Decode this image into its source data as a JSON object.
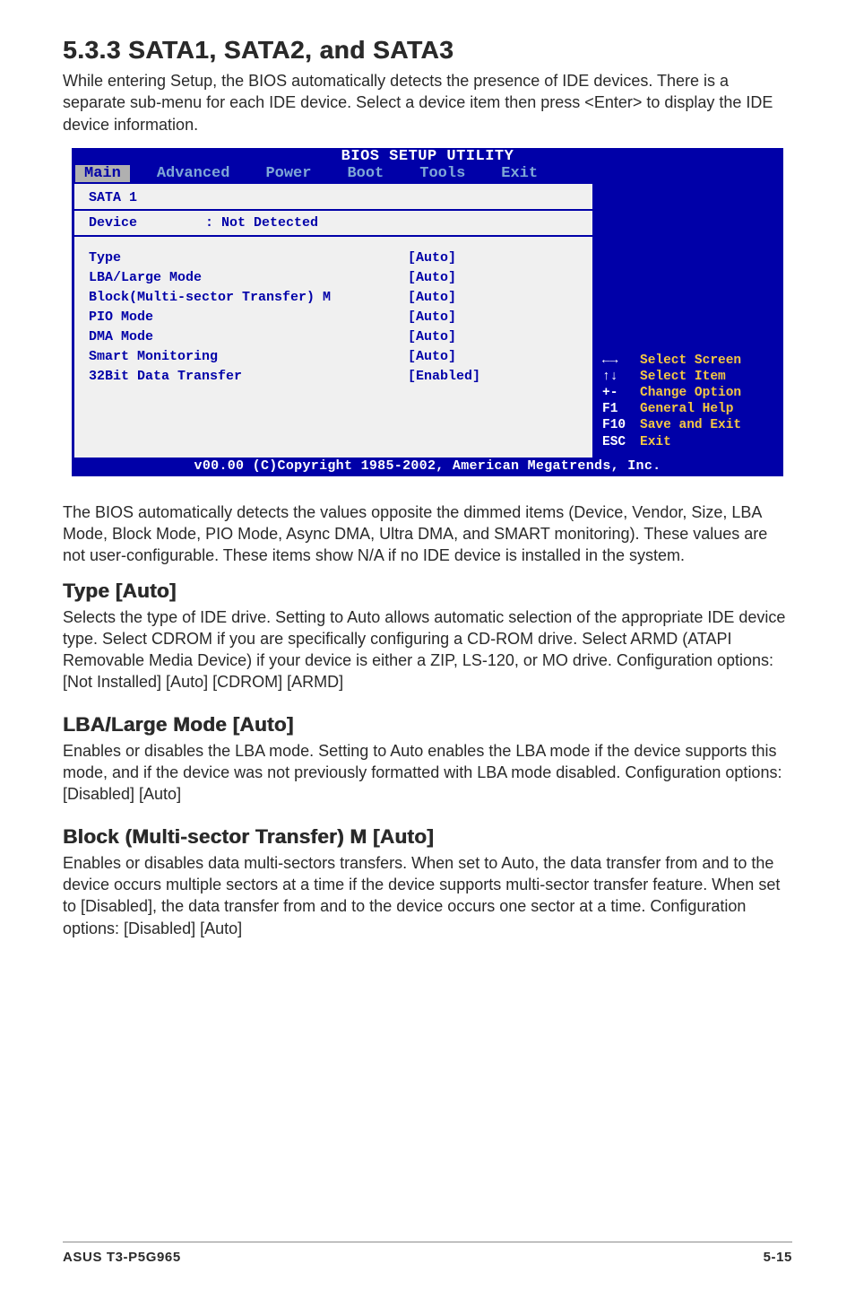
{
  "h2": "5.3.3   SATA1, SATA2, and SATA3",
  "intro": "While entering Setup, the BIOS automatically detects the presence of IDE devices. There is a separate sub-menu for each IDE device. Select a device item then press <Enter> to display the IDE device information.",
  "bios": {
    "title": "BIOS SETUP UTILITY",
    "tabs": [
      "Main",
      "Advanced",
      "Power",
      "Boot",
      "Tools",
      "Exit"
    ],
    "active_tab": "Main",
    "section_title": "SATA 1",
    "device_label": "Device",
    "device_value": ": Not Detected",
    "rows": [
      {
        "label": "Type",
        "val": "[Auto]"
      },
      {
        "label": "LBA/Large Mode",
        "val": "[Auto]"
      },
      {
        "label": "Block(Multi-sector Transfer) M",
        "val": "[Auto]"
      },
      {
        "label": "PIO Mode",
        "val": "[Auto]"
      },
      {
        "label": "DMA Mode",
        "val": "[Auto]"
      },
      {
        "label": "Smart Monitoring",
        "val": "[Auto]"
      },
      {
        "label": "32Bit Data Transfer",
        "val": "[Enabled]"
      }
    ],
    "help": [
      {
        "key": "←→",
        "lbl": "Select Screen"
      },
      {
        "key": "↑↓",
        "lbl": "Select Item"
      },
      {
        "key": "+-",
        "lbl": "Change Option"
      },
      {
        "key": "F1",
        "lbl": "General Help"
      },
      {
        "key": "F10",
        "lbl": "Save and Exit"
      },
      {
        "key": "ESC",
        "lbl": "Exit"
      }
    ],
    "footer": "v00.00 (C)Copyright 1985-2002, American Megatrends, Inc."
  },
  "after_bios": "The BIOS automatically detects the values opposite the dimmed items (Device, Vendor, Size, LBA Mode, Block Mode, PIO Mode, Async DMA, Ultra DMA, and SMART monitoring). These values are not user-configurable. These items show N/A if no IDE device is installed in the system.",
  "type": {
    "h": "Type [Auto]",
    "p": "Selects the type of IDE drive. Setting to Auto allows automatic selection of the appropriate IDE device type. Select CDROM if you are specifically configuring a CD-ROM drive. Select ARMD (ATAPI Removable Media Device) if your device is either a ZIP, LS-120, or MO drive. Configuration options: [Not Installed] [Auto] [CDROM] [ARMD]"
  },
  "lba": {
    "h": "LBA/Large Mode [Auto]",
    "p": "Enables or disables the LBA mode. Setting to Auto enables the LBA mode if the device supports this mode, and if the device was not previously formatted with LBA mode disabled. Configuration options: [Disabled] [Auto]"
  },
  "block": {
    "h": "Block (Multi-sector Transfer) M [Auto]",
    "p": "Enables or disables data multi-sectors transfers. When set to Auto, the data transfer from and to the device occurs multiple sectors at a time if the device supports multi-sector transfer feature. When set to [Disabled], the data transfer from and to the device occurs one sector at a time. Configuration options: [Disabled] [Auto]"
  },
  "footer": {
    "left": "ASUS T3-P5G965",
    "right": "5-15"
  }
}
